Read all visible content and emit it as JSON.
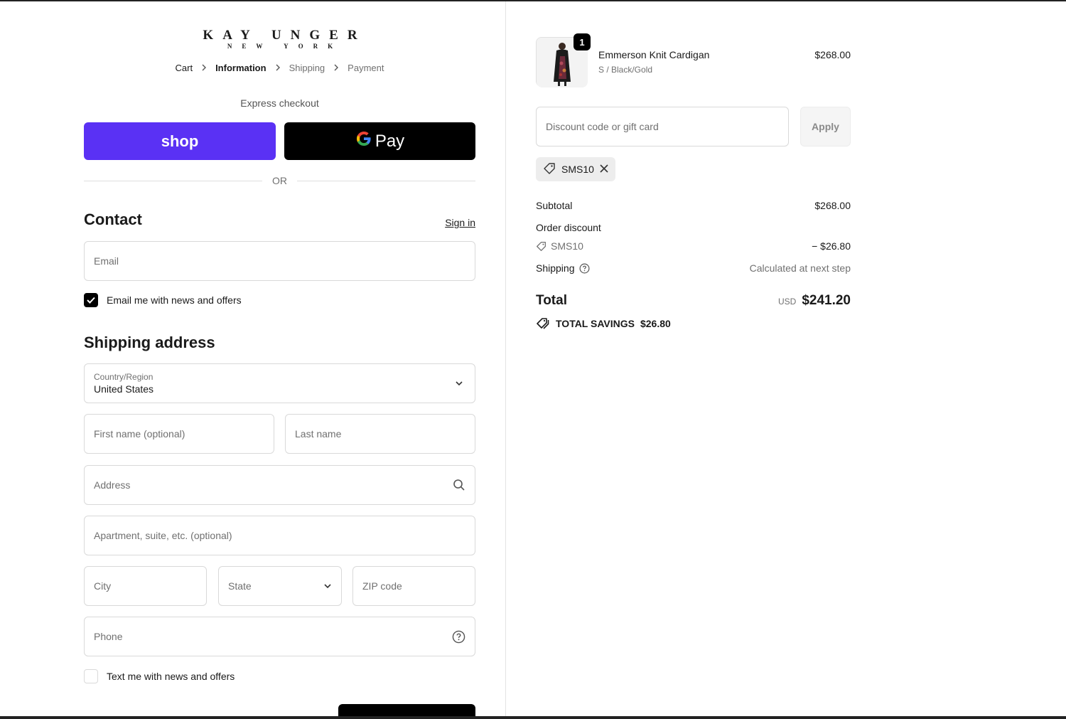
{
  "brand": {
    "name": "KAY UNGER",
    "sub": "NEW YORK"
  },
  "breadcrumb": [
    {
      "label": "Cart"
    },
    {
      "label": "Information"
    },
    {
      "label": "Shipping"
    },
    {
      "label": "Payment"
    }
  ],
  "express": {
    "label": "Express checkout",
    "shop_label": "shop",
    "gpay_label": "Pay",
    "or_label": "OR",
    "shop_color": "#5a31f4"
  },
  "contact": {
    "title": "Contact",
    "signin_label": "Sign in",
    "email_placeholder": "Email",
    "newsletter_label": "Email me with news and offers",
    "newsletter_checked": true
  },
  "shipping": {
    "title": "Shipping address",
    "country_label": "Country/Region",
    "country_value": "United States",
    "first_name_placeholder": "First name (optional)",
    "last_name_placeholder": "Last name",
    "address_placeholder": "Address",
    "apartment_placeholder": "Apartment, suite, etc. (optional)",
    "city_placeholder": "City",
    "state_placeholder": "State",
    "zip_placeholder": "ZIP code",
    "phone_placeholder": "Phone",
    "sms_label": "Text me with news and offers",
    "sms_checked": false
  },
  "order": {
    "product": {
      "name": "Emmerson Knit Cardigan",
      "variant": "S / Black/Gold",
      "price": "$268.00",
      "quantity": "1"
    },
    "discount_placeholder": "Discount code or gift card",
    "apply_label": "Apply",
    "applied_code": "SMS10",
    "subtotal_label": "Subtotal",
    "subtotal_value": "$268.00",
    "order_discount_label": "Order discount",
    "discount_code": "SMS10",
    "discount_value": "− $26.80",
    "shipping_label": "Shipping",
    "shipping_value": "Calculated at next step",
    "total_label": "Total",
    "total_currency": "USD",
    "total_value": "$241.20",
    "savings_label": "TOTAL SAVINGS",
    "savings_value": "$26.80"
  }
}
